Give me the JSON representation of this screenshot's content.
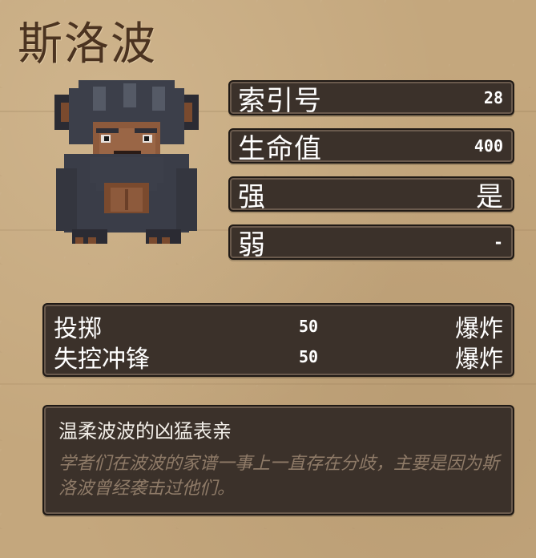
{
  "monster": {
    "name": "斯洛波",
    "portrait_icon": "sloth-bear-monster-portrait"
  },
  "stats": [
    {
      "label": "索引号",
      "value": "28"
    },
    {
      "label": "生命值",
      "value": "400"
    },
    {
      "label": "强",
      "value": "是"
    },
    {
      "label": "弱",
      "value": "-"
    }
  ],
  "abilities": [
    {
      "name": "投掷",
      "power": "50",
      "type": "爆炸"
    },
    {
      "name": "失控冲锋",
      "power": "50",
      "type": "爆炸"
    }
  ],
  "description": {
    "flavor": "温柔波波的凶猛表亲",
    "lore": "学者们在波波的家谱一事上一直存在分歧，主要是因为斯洛波曾经袭击过他们。"
  },
  "colors": {
    "background": "#c4a77d",
    "panel": "#3b312a",
    "panel_border": "#6a5a4d",
    "title": "#4b3320",
    "lore_text": "#8f7b68"
  }
}
